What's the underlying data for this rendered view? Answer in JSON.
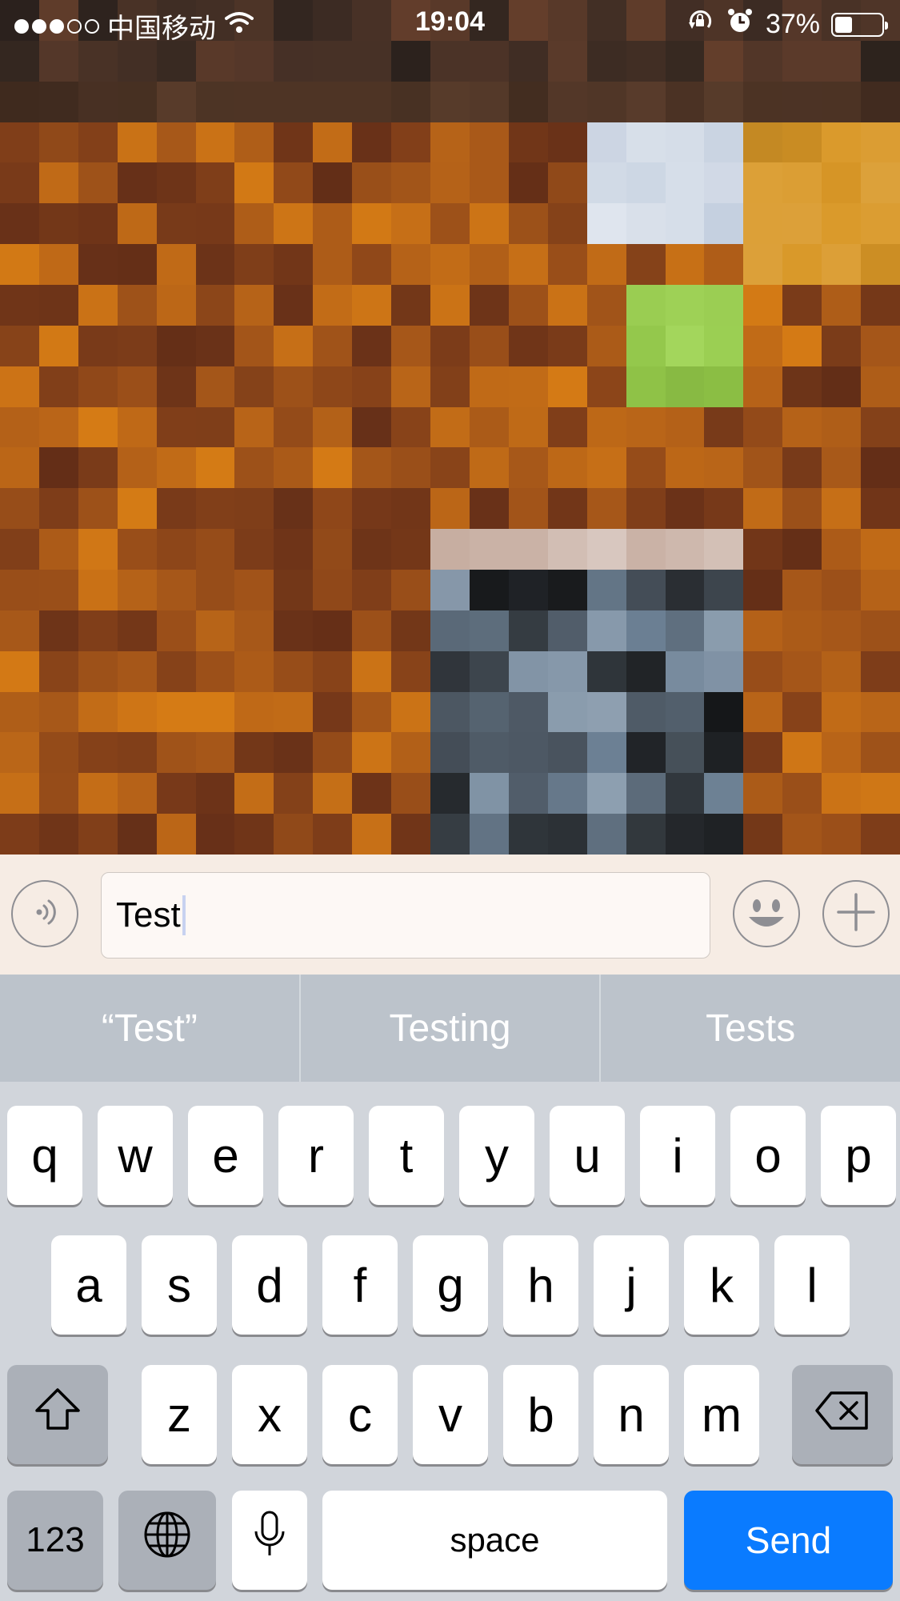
{
  "status_bar": {
    "carrier": "中国移动",
    "time": "19:04",
    "battery_percent": "37%",
    "battery_level": 0.37,
    "signal_filled": 3,
    "signal_total": 5
  },
  "input_bar": {
    "text_value": "Test",
    "voice_icon": "voice-waves-icon",
    "emoji_icon": "smiley-icon",
    "plus_icon": "plus-icon"
  },
  "suggestions": [
    "“Test”",
    "Testing",
    "Tests"
  ],
  "keyboard": {
    "row1": [
      "q",
      "w",
      "e",
      "r",
      "t",
      "y",
      "u",
      "i",
      "o",
      "p"
    ],
    "row2": [
      "a",
      "s",
      "d",
      "f",
      "g",
      "h",
      "j",
      "k",
      "l"
    ],
    "row3": [
      "z",
      "x",
      "c",
      "v",
      "b",
      "n",
      "m"
    ],
    "numbers_label": "123",
    "space_label": "space",
    "send_label": "Send"
  },
  "colors": {
    "send_blue": "#0a7bff",
    "keyboard_bg": "#d1d5db",
    "suggestion_bg": "#bcc3cb"
  }
}
